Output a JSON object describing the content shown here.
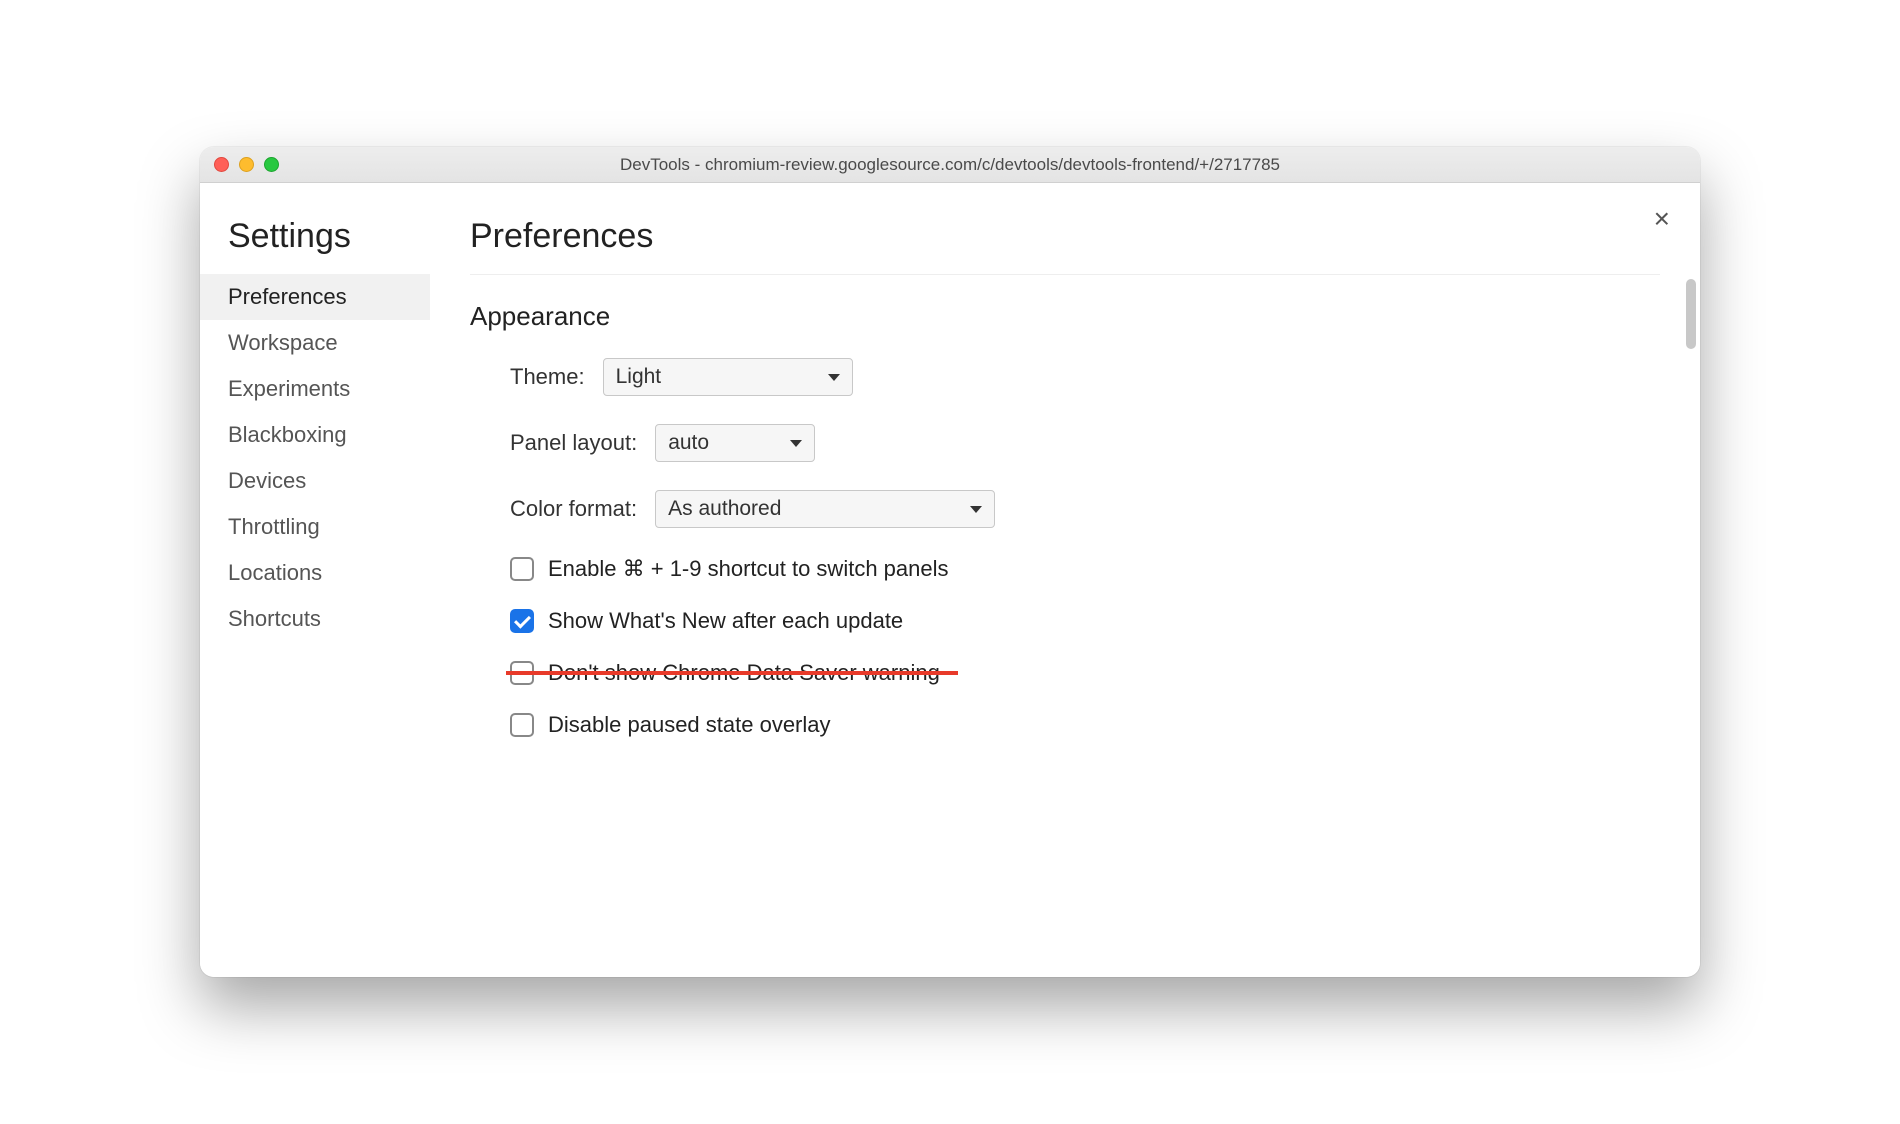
{
  "window": {
    "title": "DevTools - chromium-review.googlesource.com/c/devtools/devtools-frontend/+/2717785"
  },
  "sidebar": {
    "heading": "Settings",
    "items": [
      {
        "label": "Preferences",
        "active": true
      },
      {
        "label": "Workspace"
      },
      {
        "label": "Experiments"
      },
      {
        "label": "Blackboxing"
      },
      {
        "label": "Devices"
      },
      {
        "label": "Throttling"
      },
      {
        "label": "Locations"
      },
      {
        "label": "Shortcuts"
      }
    ]
  },
  "main": {
    "title": "Preferences",
    "appearance": {
      "heading": "Appearance",
      "theme_label": "Theme:",
      "theme_value": "Light",
      "panel_label": "Panel layout:",
      "panel_value": "auto",
      "color_label": "Color format:",
      "color_value": "As authored",
      "checkboxes": [
        {
          "label": "Enable ⌘ + 1-9 shortcut to switch panels",
          "checked": false,
          "struck": false
        },
        {
          "label": "Show What's New after each update",
          "checked": true,
          "struck": false
        },
        {
          "label": "Don't show Chrome Data Saver warning",
          "checked": false,
          "struck": true
        },
        {
          "label": "Disable paused state overlay",
          "checked": false,
          "struck": false
        }
      ]
    }
  },
  "close_glyph": "×"
}
